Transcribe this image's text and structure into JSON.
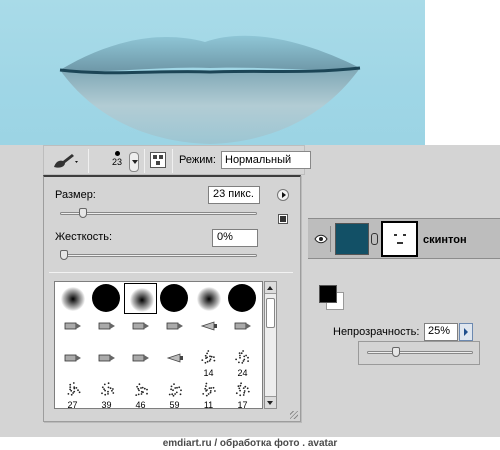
{
  "options_bar": {
    "brush_size_display": "23",
    "mode_label": "Режим:",
    "mode_value": "Нормальный"
  },
  "brush_panel": {
    "size_label": "Размер:",
    "size_value": "23 пикс.",
    "size_slider_fraction": 0.1,
    "hardness_label": "Жесткость:",
    "hardness_value": "0%",
    "hardness_slider_fraction": 0.0,
    "presets": [
      {
        "kind": "soft",
        "label": "",
        "selected": false
      },
      {
        "kind": "hard",
        "label": "",
        "selected": false
      },
      {
        "kind": "soft",
        "label": "",
        "selected": true
      },
      {
        "kind": "hard",
        "label": "",
        "selected": false
      },
      {
        "kind": "soft",
        "label": "",
        "selected": false
      },
      {
        "kind": "hard",
        "label": "",
        "selected": false
      },
      {
        "kind": "tip",
        "label": "",
        "selected": false
      },
      {
        "kind": "tip",
        "label": "",
        "selected": false
      },
      {
        "kind": "tip",
        "label": "",
        "selected": false
      },
      {
        "kind": "tip",
        "label": "",
        "selected": false
      },
      {
        "kind": "fan",
        "label": "",
        "selected": false
      },
      {
        "kind": "tip",
        "label": "",
        "selected": false
      },
      {
        "kind": "tip",
        "label": "",
        "selected": false
      },
      {
        "kind": "tip",
        "label": "",
        "selected": false
      },
      {
        "kind": "tip",
        "label": "",
        "selected": false
      },
      {
        "kind": "fan",
        "label": "",
        "selected": false
      },
      {
        "kind": "splatter",
        "label": "14",
        "selected": false
      },
      {
        "kind": "splatter",
        "label": "24",
        "selected": false
      },
      {
        "kind": "splatter",
        "label": "27",
        "selected": false
      },
      {
        "kind": "splatter",
        "label": "39",
        "selected": false
      },
      {
        "kind": "splatter",
        "label": "46",
        "selected": false
      },
      {
        "kind": "splatter",
        "label": "59",
        "selected": false
      },
      {
        "kind": "splatter",
        "label": "11",
        "selected": false
      },
      {
        "kind": "splatter",
        "label": "17",
        "selected": false
      }
    ]
  },
  "layer": {
    "name": "скинтон",
    "thumb_color": "#125066"
  },
  "colors": {
    "foreground": "#000000",
    "background": "#ffffff"
  },
  "opacity": {
    "label": "Непрозрачность:",
    "value": "25%",
    "slider_fraction": 0.25
  },
  "footer": {
    "text": "emdiart.ru   / обработка фото . avatar"
  }
}
